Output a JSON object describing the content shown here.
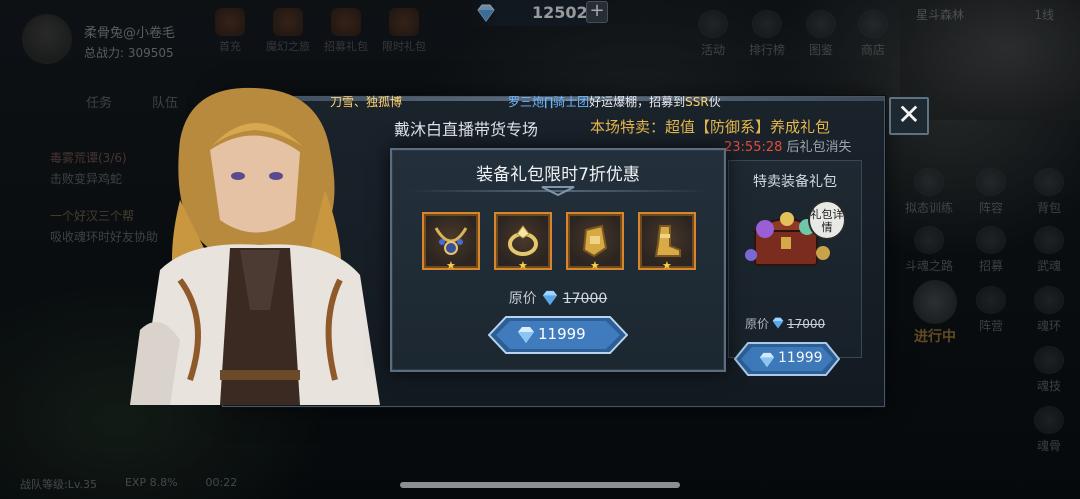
{
  "player": {
    "name": "柔骨兔@小卷毛",
    "power": "总战力: 309505"
  },
  "top_icons": [
    "首充",
    "魔幻之旅",
    "招募礼包",
    "限时礼包"
  ],
  "currency": {
    "amount": "12502",
    "plus": "+"
  },
  "map": {
    "name": "星斗森林",
    "line": "1线"
  },
  "right_top_icons": [
    "活动",
    "排行榜",
    "图鉴",
    "商店"
  ],
  "right_icons": [
    "拟态训练",
    "阵容",
    "背包",
    "斗魂之路",
    "招募",
    "武魂",
    "阵营",
    "魂环",
    "魂技",
    "魂骨"
  ],
  "in_progress": "进行中",
  "task_panel": {
    "tab_task": "任务",
    "tab_team": "队伍",
    "task1": "毒雾荒谭(3/6)",
    "task1_desc": "击败变异鸡蛇",
    "task2": "一个好汉三个帮",
    "task2_desc": "吸收魂环时好友协助"
  },
  "bottom_bar": {
    "level": "战队等级:Lv.35",
    "exp": "EXP 8.8%",
    "time": "00:22"
  },
  "ticker": {
    "left": "刀雪、独孤博",
    "team": "罗三炮∏骑士团",
    "mid": "好运爆棚，招募到",
    "ssr": "SSR",
    "end": "伙"
  },
  "popup": {
    "host_title": "戴沐白直播带货专场",
    "special_prefix": "本场特卖：超值【防御系】养成礼包",
    "countdown_time": "23:55:28",
    "countdown_rest": "后礼包消失",
    "close": "✕"
  },
  "side_card": {
    "title": "特卖装备礼包",
    "detail_badge": "礼包详情",
    "orig_label": "原价",
    "orig_price": "17000",
    "price": "11999"
  },
  "inner_dialog": {
    "title": "装备礼包限时7折优惠",
    "items": [
      {
        "name": "necklace",
        "star": "★"
      },
      {
        "name": "ring",
        "star": "★"
      },
      {
        "name": "gauntlet",
        "star": "★"
      },
      {
        "name": "boots",
        "star": "★"
      }
    ],
    "orig_label": "原价",
    "orig_price": "17000",
    "price": "11999"
  },
  "colors": {
    "accent_orange": "#d9852b",
    "price_blue": "#2f6fb3",
    "gold_text": "#e6b84c",
    "countdown_red": "#e34b3b"
  }
}
